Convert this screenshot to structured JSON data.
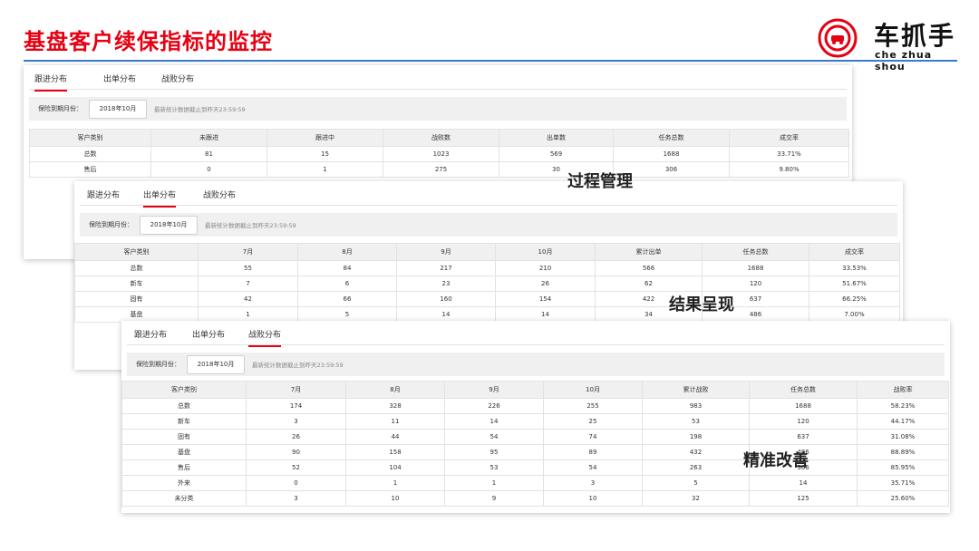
{
  "slide": {
    "title": "基盘客户续保指标的监控",
    "logo_cn": "车抓手",
    "logo_en": "che zhua shou"
  },
  "tabs": [
    "跟进分布",
    "出单分布",
    "战败分布"
  ],
  "filter": {
    "label": "保险到期月份：",
    "value": "2018年10月",
    "note": "最新统计数据截止到昨天23:59:59"
  },
  "panel1": {
    "active_tab": "跟进分布",
    "columns": [
      "客户类别",
      "未跟进",
      "跟进中",
      "战败数",
      "出单数",
      "任务总数",
      "成交率"
    ],
    "rows": [
      [
        "总数",
        "81",
        "15",
        "1023",
        "569",
        "1688",
        "33.71%"
      ],
      [
        "售后",
        "0",
        "1",
        "275",
        "30",
        "306",
        "9.80%"
      ]
    ]
  },
  "panel2": {
    "active_tab": "出单分布",
    "columns": [
      "客户类别",
      "7月",
      "8月",
      "9月",
      "10月",
      "累计出单",
      "任务总数",
      "成交率"
    ],
    "rows": [
      [
        "总数",
        "55",
        "84",
        "217",
        "210",
        "566",
        "1688",
        "33.53%"
      ],
      [
        "新车",
        "7",
        "6",
        "23",
        "26",
        "62",
        "120",
        "51.67%"
      ],
      [
        "固有",
        "42",
        "66",
        "160",
        "154",
        "422",
        "637",
        "66.25%"
      ],
      [
        "基盘",
        "1",
        "5",
        "14",
        "14",
        "34",
        "486",
        "7.00%"
      ]
    ]
  },
  "panel3": {
    "active_tab": "战败分布",
    "columns": [
      "客户类别",
      "7月",
      "8月",
      "9月",
      "10月",
      "累计战败",
      "任务总数",
      "战败率"
    ],
    "rows": [
      [
        "总数",
        "174",
        "328",
        "226",
        "255",
        "983",
        "1688",
        "58.23%"
      ],
      [
        "新车",
        "3",
        "11",
        "14",
        "25",
        "53",
        "120",
        "44.17%"
      ],
      [
        "固有",
        "26",
        "44",
        "54",
        "74",
        "198",
        "637",
        "31.08%"
      ],
      [
        "基盘",
        "90",
        "158",
        "95",
        "89",
        "432",
        "486",
        "88.89%"
      ],
      [
        "售后",
        "52",
        "104",
        "53",
        "54",
        "263",
        "306",
        "85.95%"
      ],
      [
        "外来",
        "0",
        "1",
        "1",
        "3",
        "5",
        "14",
        "35.71%"
      ],
      [
        "未分类",
        "3",
        "10",
        "9",
        "10",
        "32",
        "125",
        "25.60%"
      ]
    ]
  },
  "callouts": {
    "process": "过程管理",
    "result": "结果呈现",
    "improve": "精准改善"
  },
  "colors": {
    "title_red": "#e60012",
    "rule_blue": "#3a7cc7",
    "header_gray": "#f0f0f0"
  }
}
